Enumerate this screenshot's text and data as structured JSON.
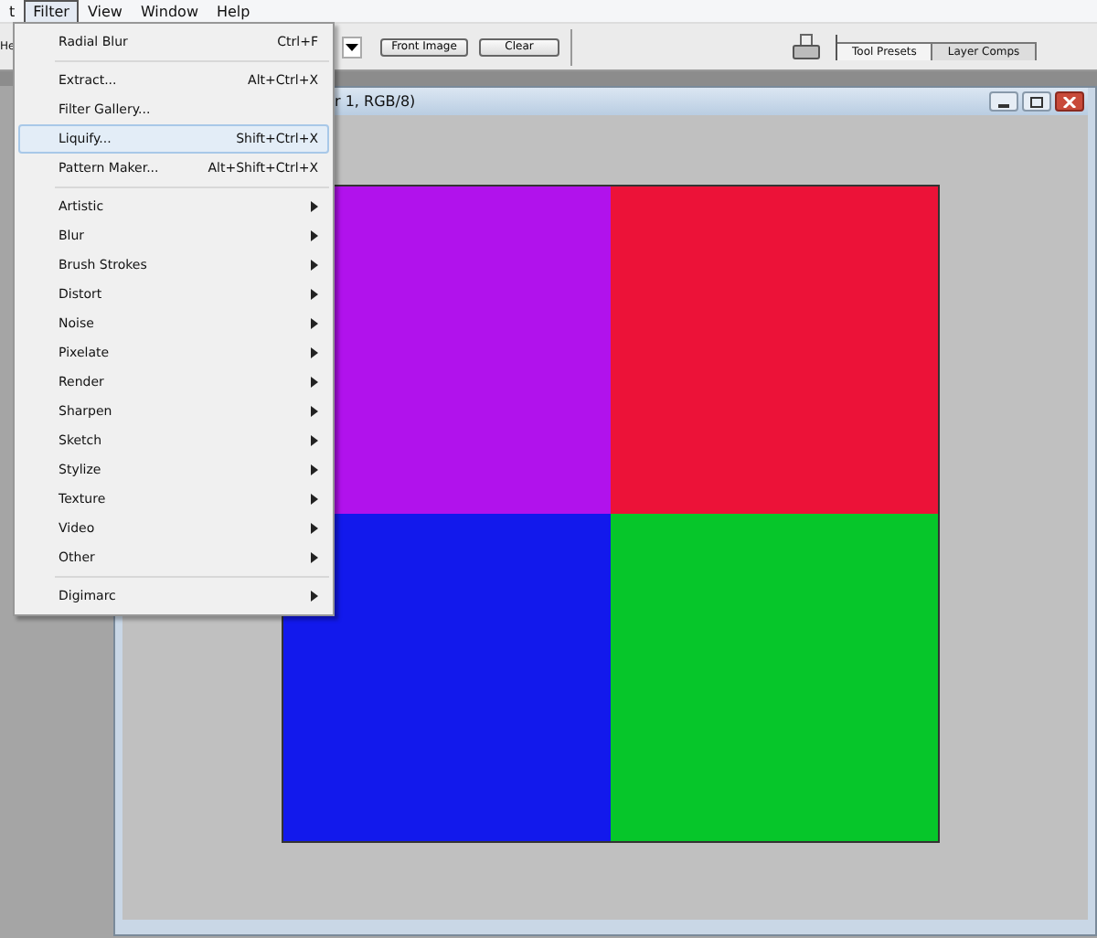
{
  "menubar": [
    {
      "label": "t",
      "selected": false
    },
    {
      "label": "Filter",
      "selected": true
    },
    {
      "label": "View",
      "selected": false
    },
    {
      "label": "Window",
      "selected": false
    },
    {
      "label": "Help",
      "selected": false
    }
  ],
  "toolbar": {
    "cut_label": "He",
    "buttons": [
      "Front Image",
      "Clear"
    ],
    "tabs": [
      {
        "label": "Tool Presets",
        "selected": true
      },
      {
        "label": "Layer Comps",
        "selected": false
      }
    ]
  },
  "document": {
    "title": "r 1, RGB/8)",
    "quadrants": [
      {
        "color": "#b112ec"
      },
      {
        "color": "#ec1238"
      },
      {
        "color": "#1219ec"
      },
      {
        "color": "#06c62a"
      }
    ]
  },
  "filter_menu": [
    {
      "kind": "item",
      "label": "Radial Blur",
      "shortcut": "Ctrl+F",
      "selected": false
    },
    {
      "kind": "separator"
    },
    {
      "kind": "item",
      "label": "Extract...",
      "shortcut": "Alt+Ctrl+X",
      "selected": false
    },
    {
      "kind": "item",
      "label": "Filter Gallery...",
      "selected": false
    },
    {
      "kind": "item",
      "label": "Liquify...",
      "shortcut": "Shift+Ctrl+X",
      "selected": true
    },
    {
      "kind": "item",
      "label": "Pattern Maker...",
      "shortcut": "Alt+Shift+Ctrl+X",
      "selected": false
    },
    {
      "kind": "separator"
    },
    {
      "kind": "submenu",
      "label": "Artistic",
      "selected": false
    },
    {
      "kind": "submenu",
      "label": "Blur",
      "selected": false
    },
    {
      "kind": "submenu",
      "label": "Brush Strokes",
      "selected": false
    },
    {
      "kind": "submenu",
      "label": "Distort",
      "selected": false
    },
    {
      "kind": "submenu",
      "label": "Noise",
      "selected": false
    },
    {
      "kind": "submenu",
      "label": "Pixelate",
      "selected": false
    },
    {
      "kind": "submenu",
      "label": "Render",
      "selected": false
    },
    {
      "kind": "submenu",
      "label": "Sharpen",
      "selected": false
    },
    {
      "kind": "submenu",
      "label": "Sketch",
      "selected": false
    },
    {
      "kind": "submenu",
      "label": "Stylize",
      "selected": false
    },
    {
      "kind": "submenu",
      "label": "Texture",
      "selected": false
    },
    {
      "kind": "submenu",
      "label": "Video",
      "selected": false
    },
    {
      "kind": "submenu",
      "label": "Other",
      "selected": false
    },
    {
      "kind": "separator"
    },
    {
      "kind": "submenu",
      "label": "Digimarc",
      "selected": false
    }
  ]
}
